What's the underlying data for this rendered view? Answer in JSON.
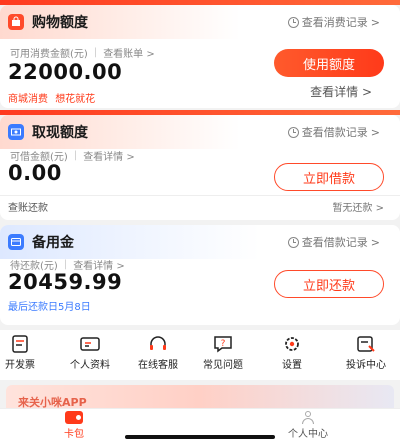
{
  "card1": {
    "title": "购物额度",
    "link": "查看消费记录",
    "sub_label": "可用消费金额(元)",
    "sub_link": "查看账单",
    "amount": "22000.00",
    "note_a": "商城消费",
    "note_b": "想花就花",
    "button": "使用额度",
    "detail_link": "查看详情"
  },
  "card2": {
    "title": "取现额度",
    "link": "查看借款记录",
    "sub_label": "可借金额(元)",
    "sub_link": "查看详情",
    "amount": "0.00",
    "button": "立即借款",
    "footer_left": "查账还款",
    "footer_right": "暂无还款"
  },
  "card3": {
    "title": "备用金",
    "link": "查看借款记录",
    "sub_label": "待还款(元)",
    "sub_link": "查看详情",
    "amount": "20459.99",
    "note": "最后还款日5月8日",
    "button": "立即还款"
  },
  "shortcuts": [
    {
      "label": "开发票",
      "icon": "invoice-icon"
    },
    {
      "label": "个人资料",
      "icon": "id-card-icon"
    },
    {
      "label": "在线客服",
      "icon": "headset-icon"
    },
    {
      "label": "常见问题",
      "icon": "question-icon"
    },
    {
      "label": "设置",
      "icon": "gear-icon"
    },
    {
      "label": "投诉中心",
      "icon": "complaint-icon"
    }
  ],
  "banner": {
    "text": "来关小咪APP"
  },
  "tabs": [
    {
      "label": "卡包",
      "icon": "wallet-icon",
      "active": true
    },
    {
      "label": "个人中心",
      "icon": "user-icon",
      "active": false
    }
  ],
  "colors": {
    "accent": "#ff3a1a",
    "blue_accent": "#3b7bff"
  }
}
